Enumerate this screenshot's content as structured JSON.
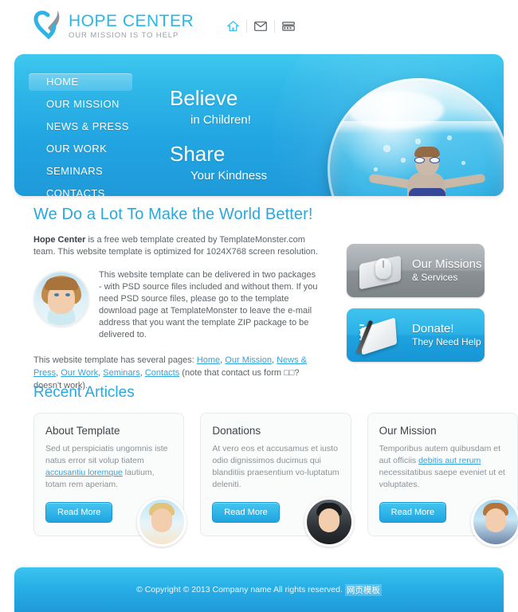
{
  "header": {
    "logo": {
      "title": "HOPE CENTER",
      "tagline": "OUR MISSION IS TO HELP"
    },
    "icons": [
      {
        "name": "home-icon",
        "glyph": "⌂"
      },
      {
        "name": "mail-icon",
        "glyph": "✉"
      },
      {
        "name": "sitemap-icon",
        "glyph": "⌸"
      }
    ]
  },
  "banner": {
    "nav": [
      {
        "label": "HOME",
        "active": true
      },
      {
        "label": "OUR MISSION",
        "active": false
      },
      {
        "label": "NEWS & PRESS",
        "active": false
      },
      {
        "label": "OUR WORK",
        "active": false
      },
      {
        "label": "SEMINARS",
        "active": false
      },
      {
        "label": "CONTACTS",
        "active": false
      }
    ],
    "slogan": {
      "line1_big": "Believe",
      "line1_small": "in Children!",
      "line2_big": "Share",
      "line2_small": "Your Kindness"
    },
    "image_alt": "child-swimming-in-fishbowl"
  },
  "main": {
    "heading": "We Do a Lot To Make the World Better!",
    "intro_bold": "Hope Center",
    "intro_rest": " is a free web template created by TemplateMonster.com team. This website template is optimized for 1024X768 screen resolution.",
    "media_text": "This website template can be delivered in two packages - with PSD source files included and without them. If you need PSD source files, please go to the template download page at TemplateMonster to leave the e-mail address that you want the template ZIP package to be delivered to.",
    "links_intro": "This website template has several pages: ",
    "page_links": [
      "Home",
      "Our Mission",
      "News & Press",
      "Our Work",
      "Seminars",
      "Contacts"
    ],
    "links_note": " (note that contact us form □□?doesn't work)."
  },
  "side_buttons": [
    {
      "name": "our-missions-services",
      "line1": "Our Missions",
      "line2": "& Services",
      "icon": "mousepad-icon",
      "color": "#9ea4a8"
    },
    {
      "name": "donate",
      "line1": "Donate!",
      "line2": "They Need Help",
      "icon": "notebook-pen-icon",
      "color": "#1fa3de"
    }
  ],
  "articles": {
    "heading": "Recent Articles",
    "read_more_label": "Read More",
    "items": [
      {
        "title": "About Template",
        "text_before": "Sed ut perspiciatis ungomnis iste natus error sit volup tiatem ",
        "link": "accusantiu loremque",
        "text_after": " lautium, totam rem aperiam.",
        "avatar": "girl-avatar"
      },
      {
        "title": "Donations",
        "text_before": "At vero eos et accusamus et iusto odio dignissimos ducimus qui blanditiis praesentium vo-luptatum deleniti.",
        "link": "",
        "text_after": "",
        "avatar": "boy-hoodie-avatar"
      },
      {
        "title": "Our Mission",
        "text_before": "Temporibus autem quibusdam et aut officiis ",
        "link": "debitis aut rerum",
        "text_after": " necessitatibus saepe eveniet ut et voluptates.",
        "avatar": "boy-avatar"
      }
    ]
  },
  "footer": {
    "copyright": "© Copyright © 2013 Company name All rights reserved.",
    "cn_text": "网页模板"
  },
  "colors": {
    "accent": "#29a8e0",
    "accent_light": "#3fc8ef",
    "heading": "#29a8e0",
    "body_text": "#5c6468",
    "muted_text": "#8b9296",
    "gray_button": "#9ea4a8"
  }
}
